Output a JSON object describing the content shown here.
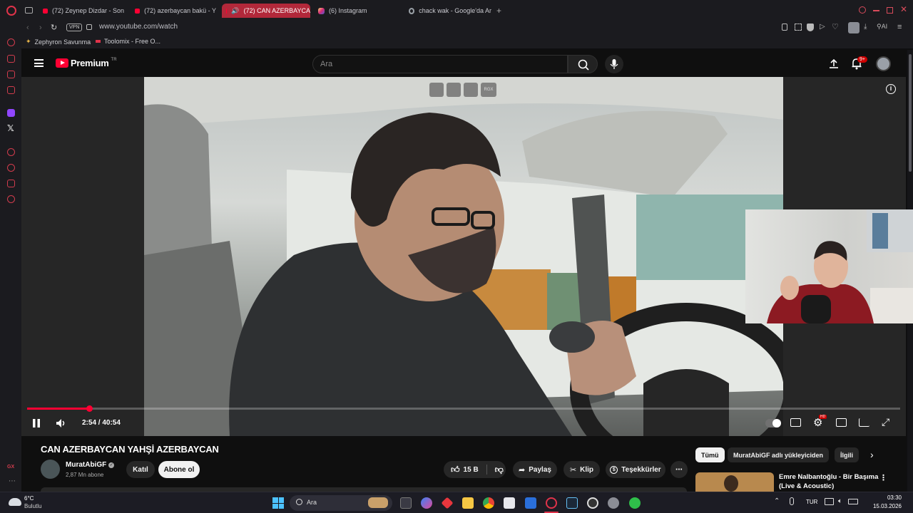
{
  "browser": {
    "tabs": [
      {
        "label": "(72) Zeynep Dizdar - Son"
      },
      {
        "label": "(72) azerbaycan bakü - Y"
      },
      {
        "label": "(72) CAN AZERBAYCA"
      },
      {
        "label": "(6) Instagram"
      },
      {
        "label": "chack wak - Google'da Ar"
      }
    ],
    "vpn_label": "VPN",
    "url": "www.youtube.com/watch",
    "bookmarks": [
      {
        "label": "Zephyron Savunma"
      },
      {
        "label": "Toolomix - Free O..."
      }
    ],
    "sidebar_gx": "GX",
    "ai_label": "AI"
  },
  "youtube": {
    "logo_text": "Premium",
    "logo_sup": "TR",
    "search_placeholder": "Ara",
    "notif_count": "9+"
  },
  "player": {
    "overlay_gx": "RGX",
    "time": "2:54 / 40:54",
    "progress": 0.071,
    "settings_badge": "HD"
  },
  "video": {
    "title": "CAN AZERBAYCAN YAHŞİ AZERBAYCAN",
    "channel": "MuratAbiGF",
    "subscribers": "2,87 Mn abone",
    "join": "Katıl",
    "subscribe": "Abone ol",
    "likes": "15 B",
    "share": "Paylaş",
    "clip": "Klip",
    "thanks": "Teşekkürler"
  },
  "recommendations": {
    "chips": [
      {
        "label": "Tümü"
      },
      {
        "label": "MuratAbiGF adlı yükleyiciden"
      },
      {
        "label": "İlgili"
      }
    ],
    "first_title_line1": "Emre Nalbantoğlu - Bir Başıma",
    "first_title_line2": "(Live & Acoustic)"
  },
  "taskbar": {
    "weather_temp": "6°C",
    "weather_desc": "Bulutlu",
    "search": "Ara",
    "lang": "TUR",
    "time": "03:30",
    "date": "15.03.2026"
  }
}
